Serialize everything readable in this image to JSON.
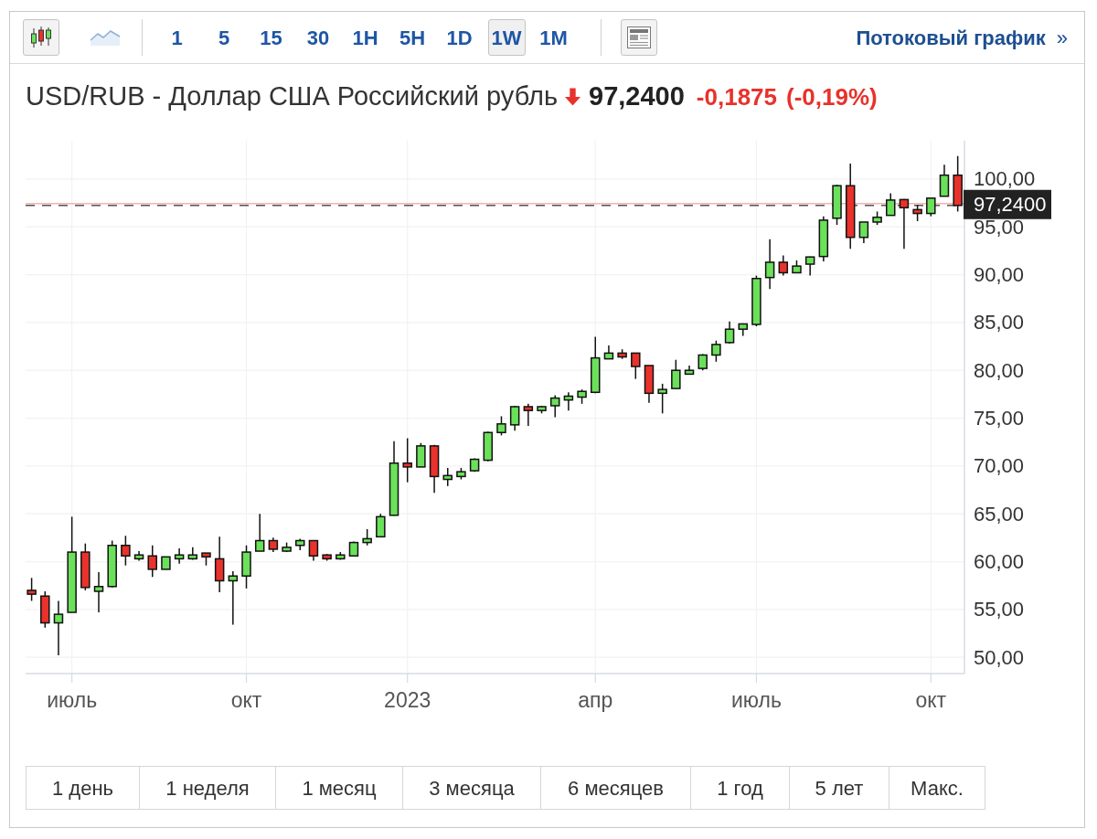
{
  "toolbar": {
    "chart_types": [
      {
        "kind": "candlestick",
        "selected": true
      },
      {
        "kind": "area",
        "selected": false
      }
    ],
    "intervals": [
      {
        "label": "1",
        "selected": false
      },
      {
        "label": "5",
        "selected": false
      },
      {
        "label": "15",
        "selected": false
      },
      {
        "label": "30",
        "selected": false
      },
      {
        "label": "1H",
        "selected": false
      },
      {
        "label": "5H",
        "selected": false
      },
      {
        "label": "1D",
        "selected": false
      },
      {
        "label": "1W",
        "selected": true
      },
      {
        "label": "1M",
        "selected": false
      }
    ],
    "streaming_link": "Потоковый график",
    "streaming_link_arrow": "»"
  },
  "quote": {
    "title": "USD/RUB - Доллар США Российский рубль",
    "down": true,
    "price": "97,2400",
    "change": "-0,1875",
    "change_percent": "(-0,19%)"
  },
  "chart": {
    "chart_data": {
      "type": "candlestick",
      "grid": true,
      "categories": [
        null,
        null,
        null,
        "июль",
        null,
        null,
        null,
        null,
        null,
        null,
        null,
        null,
        null,
        null,
        null,
        null,
        "окт",
        null,
        null,
        null,
        null,
        null,
        null,
        null,
        null,
        null,
        null,
        null,
        "2023",
        null,
        null,
        null,
        null,
        null,
        null,
        null,
        null,
        null,
        null,
        null,
        null,
        null,
        "апр",
        null,
        null,
        null,
        null,
        null,
        null,
        null,
        null,
        null,
        null,
        null,
        "июль",
        null,
        null,
        null,
        null,
        null,
        null,
        null,
        null,
        null,
        null,
        null,
        null,
        "окт",
        null,
        null
      ],
      "ylim": [
        48.3,
        104.0
      ],
      "yticks": [
        {
          "value": 50,
          "label": "50,00"
        },
        {
          "value": 55,
          "label": "55,00"
        },
        {
          "value": 60,
          "label": "60,00"
        },
        {
          "value": 65,
          "label": "65,00"
        },
        {
          "value": 70,
          "label": "70,00"
        },
        {
          "value": 75,
          "label": "75,00"
        },
        {
          "value": 80,
          "label": "80,00"
        },
        {
          "value": 85,
          "label": "85,00"
        },
        {
          "value": 90,
          "label": "90,00"
        },
        {
          "value": 95,
          "label": "95,00"
        },
        {
          "value": 100,
          "label": "100,00"
        }
      ],
      "ohlc": [
        [
          57.0,
          58.3,
          55.9,
          56.6
        ],
        [
          56.4,
          56.9,
          53.1,
          53.6
        ],
        [
          53.6,
          55.9,
          50.2,
          54.5
        ],
        [
          54.7,
          64.7,
          54.7,
          61.0
        ],
        [
          61.0,
          61.9,
          57.0,
          57.3
        ],
        [
          56.9,
          58.9,
          54.7,
          57.4
        ],
        [
          57.4,
          62.2,
          57.3,
          61.7
        ],
        [
          61.7,
          62.7,
          59.6,
          60.6
        ],
        [
          60.3,
          61.1,
          60.1,
          60.7
        ],
        [
          60.6,
          61.7,
          58.4,
          59.2
        ],
        [
          59.2,
          60.5,
          59.2,
          60.5
        ],
        [
          60.3,
          61.4,
          59.8,
          60.7
        ],
        [
          60.3,
          61.5,
          60.2,
          60.7
        ],
        [
          60.9,
          60.9,
          59.6,
          60.5
        ],
        [
          60.3,
          62.6,
          56.8,
          58.0
        ],
        [
          58.0,
          59.0,
          53.4,
          58.5
        ],
        [
          58.5,
          61.7,
          57.2,
          61.0
        ],
        [
          61.1,
          65.0,
          61.1,
          62.2
        ],
        [
          62.2,
          62.5,
          61.0,
          61.3
        ],
        [
          61.1,
          62.0,
          61.0,
          61.5
        ],
        [
          61.7,
          62.4,
          61.2,
          62.2
        ],
        [
          62.2,
          62.2,
          60.1,
          60.6
        ],
        [
          60.7,
          60.8,
          60.1,
          60.3
        ],
        [
          60.3,
          61.0,
          60.2,
          60.7
        ],
        [
          60.6,
          62.1,
          60.6,
          62.0
        ],
        [
          62.0,
          63.4,
          61.7,
          62.4
        ],
        [
          62.6,
          65.0,
          62.6,
          64.7
        ],
        [
          64.85,
          72.6,
          64.8,
          70.3
        ],
        [
          70.3,
          72.9,
          68.3,
          69.9
        ],
        [
          69.9,
          72.4,
          69.9,
          72.1
        ],
        [
          72.1,
          72.2,
          67.2,
          68.9
        ],
        [
          68.6,
          69.8,
          67.9,
          69.0
        ],
        [
          68.9,
          69.8,
          68.6,
          69.4
        ],
        [
          69.5,
          70.8,
          69.4,
          70.7
        ],
        [
          70.6,
          73.6,
          70.5,
          73.5
        ],
        [
          73.5,
          75.2,
          73.2,
          74.4
        ],
        [
          74.3,
          76.3,
          73.7,
          76.2
        ],
        [
          76.2,
          76.5,
          74.2,
          75.8
        ],
        [
          75.8,
          76.3,
          75.5,
          76.2
        ],
        [
          76.3,
          77.4,
          75.1,
          77.1
        ],
        [
          76.9,
          77.7,
          75.8,
          77.3
        ],
        [
          77.2,
          78.0,
          76.5,
          77.8
        ],
        [
          77.7,
          83.5,
          77.6,
          81.3
        ],
        [
          81.2,
          82.6,
          81.2,
          81.8
        ],
        [
          81.8,
          82.2,
          81.2,
          81.4
        ],
        [
          81.8,
          81.8,
          79.1,
          80.4
        ],
        [
          80.5,
          80.5,
          76.6,
          77.6
        ],
        [
          77.6,
          78.6,
          75.5,
          78.0
        ],
        [
          78.1,
          81.1,
          78.1,
          80.0
        ],
        [
          79.6,
          80.5,
          79.6,
          80.0
        ],
        [
          80.2,
          81.7,
          80.0,
          81.6
        ],
        [
          81.6,
          83.1,
          80.9,
          82.7
        ],
        [
          82.9,
          85.1,
          82.8,
          84.3
        ],
        [
          84.3,
          84.9,
          83.6,
          84.85
        ],
        [
          84.8,
          89.9,
          84.6,
          89.6
        ],
        [
          89.7,
          93.7,
          88.5,
          91.3
        ],
        [
          91.3,
          92.0,
          89.9,
          90.2
        ],
        [
          90.2,
          91.5,
          90.2,
          90.9
        ],
        [
          91.1,
          91.9,
          89.9,
          91.85
        ],
        [
          91.9,
          96.1,
          91.4,
          95.7
        ],
        [
          95.9,
          99.4,
          95.2,
          99.3
        ],
        [
          99.3,
          101.6,
          92.7,
          93.9
        ],
        [
          93.9,
          95.5,
          93.3,
          95.5
        ],
        [
          95.5,
          96.6,
          95.2,
          96.0
        ],
        [
          96.2,
          98.5,
          96.2,
          97.8
        ],
        [
          97.85,
          97.9,
          92.7,
          97.0
        ],
        [
          96.8,
          97.3,
          95.6,
          96.4
        ],
        [
          96.4,
          98.0,
          96.1,
          98.0
        ],
        [
          98.2,
          101.5,
          98.2,
          100.4
        ],
        [
          100.4,
          102.4,
          96.6,
          97.24
        ]
      ],
      "ref_lines": [
        {
          "axis": "y",
          "value": 97.43,
          "color": "#f4b3b0"
        },
        {
          "axis": "y",
          "value": 97.24,
          "color": "#555555",
          "label": "97,2400"
        }
      ]
    }
  },
  "ranges": [
    {
      "label": "1 день",
      "selected": false
    },
    {
      "label": "1 неделя",
      "selected": false
    },
    {
      "label": "1 месяц",
      "selected": false
    },
    {
      "label": "3 месяца",
      "selected": false
    },
    {
      "label": "6 месяцев",
      "selected": false
    },
    {
      "label": "1 год",
      "selected": false
    },
    {
      "label": "5 лет",
      "selected": false
    },
    {
      "label": "Макс.",
      "selected": false
    }
  ]
}
